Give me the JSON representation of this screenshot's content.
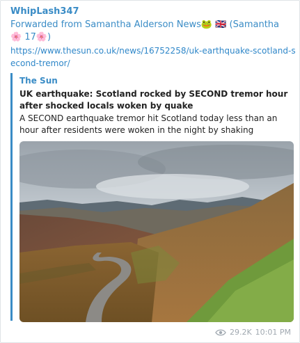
{
  "message": {
    "sender": "WhipLash347",
    "forwarded_prefix": "Forwarded from ",
    "forwarded_name": "Samantha Alderson News",
    "forwarded_emoji": "🐸 🇬🇧",
    "forwarded_suffix": " (Samantha 🌸 17🌸)",
    "link": "https://www.thesun.co.uk/news/16752258/uk-earthquake-scotland-second-tremor/"
  },
  "preview": {
    "site": "The Sun",
    "title": "UK earthquake: Scotland rocked by SECOND tremor hour after shocked locals woken by quake",
    "description": "A SECOND earthquake tremor hit Scotland today less than an hour after residents were woken in the night by shaking homes.T..."
  },
  "footer": {
    "views": "29.2K",
    "time": "10:01 PM",
    "views_icon": "eye-icon"
  },
  "colors": {
    "accent": "#3a8cc6",
    "meta": "#a0a8b0"
  }
}
